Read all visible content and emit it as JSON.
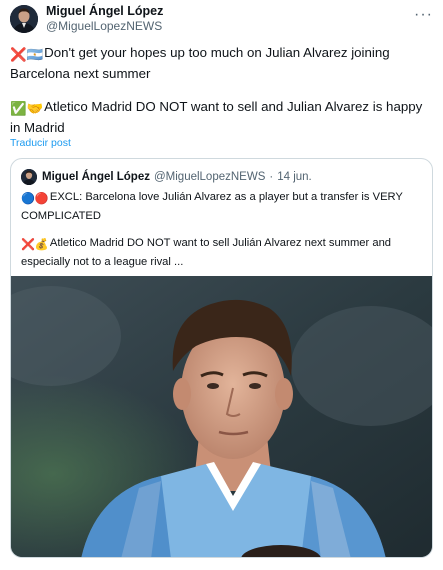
{
  "tweet": {
    "author": {
      "name": "Miguel Ángel López",
      "handle": "@MiguelLopezNEWS"
    },
    "more_label": "···",
    "paragraph1": {
      "emojis": "❌🇦🇷",
      "text": "Don't get your hopes up too much on Julian Alvarez joining Barcelona next summer"
    },
    "paragraph2": {
      "emojis": "✅🤝",
      "text": "Atletico Madrid DO NOT want to sell and Julian Alvarez is happy in Madrid"
    },
    "translate_label": "Traducir post"
  },
  "quoted": {
    "author": {
      "name": "Miguel Ángel López",
      "handle": "@MiguelLopezNEWS"
    },
    "separator": "·",
    "date": "14 jun.",
    "line1": {
      "emojis": "🔵🔴",
      "text": "EXCL: Barcelona love Julián Alvarez as a player but a transfer is VERY COMPLICATED"
    },
    "line2": {
      "emojis": "❌💰",
      "text": "Atletico Madrid DO NOT want to sell Julián Alvarez next summer and especially not to a league rival ..."
    }
  },
  "colors": {
    "link": "#1d9bf0",
    "muted": "#536471",
    "text": "#0f1419",
    "border": "#cfd9de"
  },
  "icons": [
    "author-avatar",
    "more-options-icon",
    "quoted-author-avatar",
    "player-photo"
  ]
}
